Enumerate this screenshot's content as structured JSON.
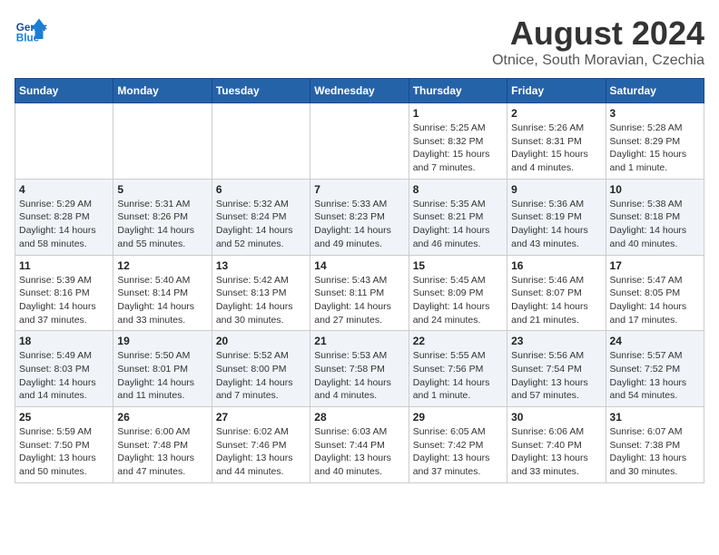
{
  "header": {
    "logo_line1": "General",
    "logo_line2": "Blue",
    "month": "August 2024",
    "location": "Otnice, South Moravian, Czechia"
  },
  "weekdays": [
    "Sunday",
    "Monday",
    "Tuesday",
    "Wednesday",
    "Thursday",
    "Friday",
    "Saturday"
  ],
  "weeks": [
    [
      {
        "day": "",
        "info": ""
      },
      {
        "day": "",
        "info": ""
      },
      {
        "day": "",
        "info": ""
      },
      {
        "day": "",
        "info": ""
      },
      {
        "day": "1",
        "info": "Sunrise: 5:25 AM\nSunset: 8:32 PM\nDaylight: 15 hours\nand 7 minutes."
      },
      {
        "day": "2",
        "info": "Sunrise: 5:26 AM\nSunset: 8:31 PM\nDaylight: 15 hours\nand 4 minutes."
      },
      {
        "day": "3",
        "info": "Sunrise: 5:28 AM\nSunset: 8:29 PM\nDaylight: 15 hours\nand 1 minute."
      }
    ],
    [
      {
        "day": "4",
        "info": "Sunrise: 5:29 AM\nSunset: 8:28 PM\nDaylight: 14 hours\nand 58 minutes."
      },
      {
        "day": "5",
        "info": "Sunrise: 5:31 AM\nSunset: 8:26 PM\nDaylight: 14 hours\nand 55 minutes."
      },
      {
        "day": "6",
        "info": "Sunrise: 5:32 AM\nSunset: 8:24 PM\nDaylight: 14 hours\nand 52 minutes."
      },
      {
        "day": "7",
        "info": "Sunrise: 5:33 AM\nSunset: 8:23 PM\nDaylight: 14 hours\nand 49 minutes."
      },
      {
        "day": "8",
        "info": "Sunrise: 5:35 AM\nSunset: 8:21 PM\nDaylight: 14 hours\nand 46 minutes."
      },
      {
        "day": "9",
        "info": "Sunrise: 5:36 AM\nSunset: 8:19 PM\nDaylight: 14 hours\nand 43 minutes."
      },
      {
        "day": "10",
        "info": "Sunrise: 5:38 AM\nSunset: 8:18 PM\nDaylight: 14 hours\nand 40 minutes."
      }
    ],
    [
      {
        "day": "11",
        "info": "Sunrise: 5:39 AM\nSunset: 8:16 PM\nDaylight: 14 hours\nand 37 minutes."
      },
      {
        "day": "12",
        "info": "Sunrise: 5:40 AM\nSunset: 8:14 PM\nDaylight: 14 hours\nand 33 minutes."
      },
      {
        "day": "13",
        "info": "Sunrise: 5:42 AM\nSunset: 8:13 PM\nDaylight: 14 hours\nand 30 minutes."
      },
      {
        "day": "14",
        "info": "Sunrise: 5:43 AM\nSunset: 8:11 PM\nDaylight: 14 hours\nand 27 minutes."
      },
      {
        "day": "15",
        "info": "Sunrise: 5:45 AM\nSunset: 8:09 PM\nDaylight: 14 hours\nand 24 minutes."
      },
      {
        "day": "16",
        "info": "Sunrise: 5:46 AM\nSunset: 8:07 PM\nDaylight: 14 hours\nand 21 minutes."
      },
      {
        "day": "17",
        "info": "Sunrise: 5:47 AM\nSunset: 8:05 PM\nDaylight: 14 hours\nand 17 minutes."
      }
    ],
    [
      {
        "day": "18",
        "info": "Sunrise: 5:49 AM\nSunset: 8:03 PM\nDaylight: 14 hours\nand 14 minutes."
      },
      {
        "day": "19",
        "info": "Sunrise: 5:50 AM\nSunset: 8:01 PM\nDaylight: 14 hours\nand 11 minutes."
      },
      {
        "day": "20",
        "info": "Sunrise: 5:52 AM\nSunset: 8:00 PM\nDaylight: 14 hours\nand 7 minutes."
      },
      {
        "day": "21",
        "info": "Sunrise: 5:53 AM\nSunset: 7:58 PM\nDaylight: 14 hours\nand 4 minutes."
      },
      {
        "day": "22",
        "info": "Sunrise: 5:55 AM\nSunset: 7:56 PM\nDaylight: 14 hours\nand 1 minute."
      },
      {
        "day": "23",
        "info": "Sunrise: 5:56 AM\nSunset: 7:54 PM\nDaylight: 13 hours\nand 57 minutes."
      },
      {
        "day": "24",
        "info": "Sunrise: 5:57 AM\nSunset: 7:52 PM\nDaylight: 13 hours\nand 54 minutes."
      }
    ],
    [
      {
        "day": "25",
        "info": "Sunrise: 5:59 AM\nSunset: 7:50 PM\nDaylight: 13 hours\nand 50 minutes."
      },
      {
        "day": "26",
        "info": "Sunrise: 6:00 AM\nSunset: 7:48 PM\nDaylight: 13 hours\nand 47 minutes."
      },
      {
        "day": "27",
        "info": "Sunrise: 6:02 AM\nSunset: 7:46 PM\nDaylight: 13 hours\nand 44 minutes."
      },
      {
        "day": "28",
        "info": "Sunrise: 6:03 AM\nSunset: 7:44 PM\nDaylight: 13 hours\nand 40 minutes."
      },
      {
        "day": "29",
        "info": "Sunrise: 6:05 AM\nSunset: 7:42 PM\nDaylight: 13 hours\nand 37 minutes."
      },
      {
        "day": "30",
        "info": "Sunrise: 6:06 AM\nSunset: 7:40 PM\nDaylight: 13 hours\nand 33 minutes."
      },
      {
        "day": "31",
        "info": "Sunrise: 6:07 AM\nSunset: 7:38 PM\nDaylight: 13 hours\nand 30 minutes."
      }
    ]
  ]
}
